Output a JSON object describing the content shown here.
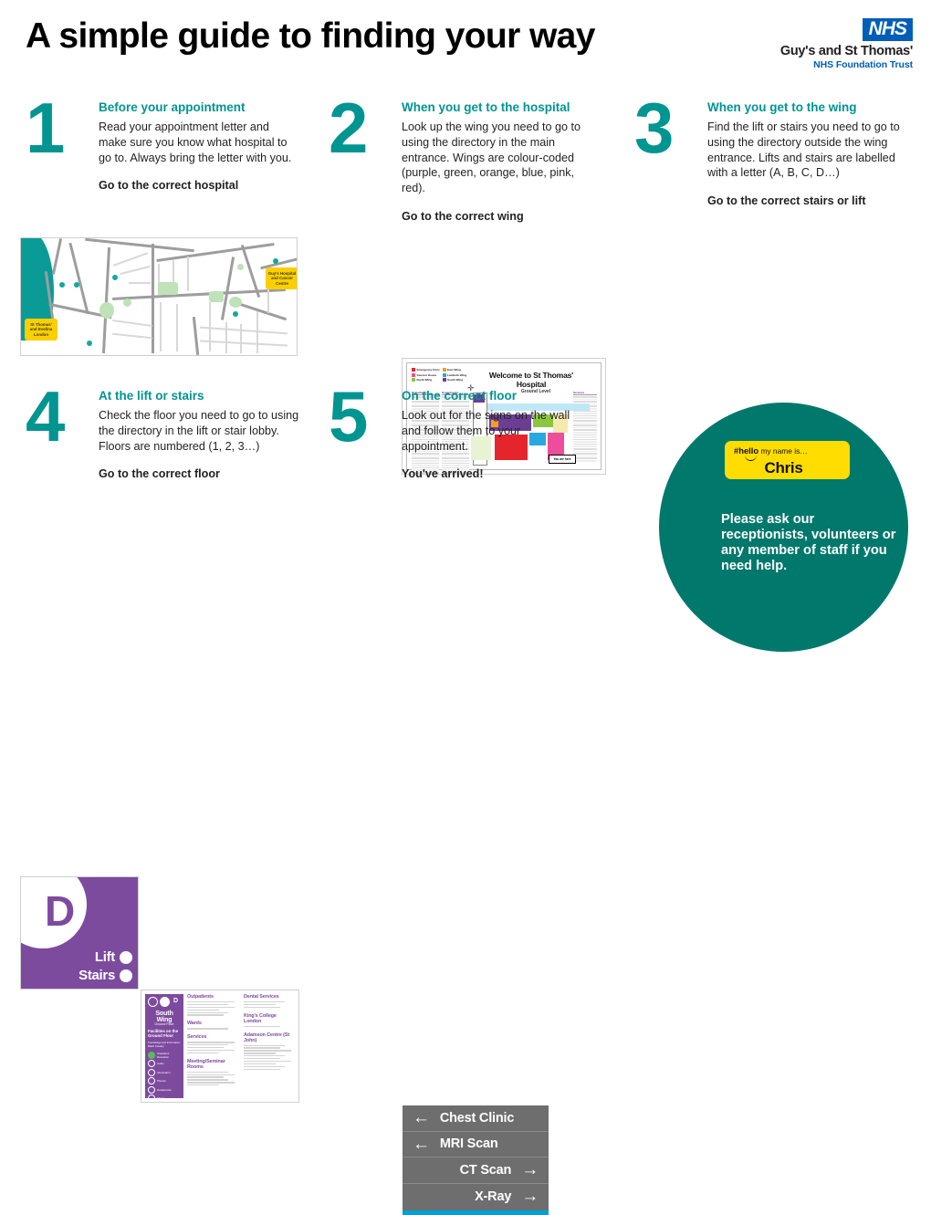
{
  "header": {
    "title": "A simple guide to finding your way",
    "logo": {
      "nhs": "NHS",
      "trust": "Guy's and St Thomas'",
      "trust_sub": "NHS Foundation Trust"
    }
  },
  "steps": [
    {
      "number": "1",
      "heading": "Before your appointment",
      "text": "Read your appointment letter and make sure you know what hospital to go to. Always bring the letter with you.",
      "action": "Go to the correct hospital"
    },
    {
      "number": "2",
      "heading": "When you get to the hospital",
      "text": "Look up the wing you need to go to using the directory in the main entrance. Wings are colour-coded (purple, green, orange, blue, pink, red).",
      "action": "Go to the correct wing"
    },
    {
      "number": "3",
      "heading": "When you get to the wing",
      "text": "Find the lift or stairs you need to go to using the directory outside the wing entrance. Lifts and stairs are labelled with a letter (A, B, C, D…)",
      "action": "Go to the correct stairs or lift"
    },
    {
      "number": "4",
      "heading": "At the lift or stairs",
      "text": "Check the floor you need to go to using the directory in the lift or stair lobby. Floors are numbered (1, 2, 3…)",
      "action": "Go to the correct floor"
    },
    {
      "number": "5",
      "heading": "On the correct floor",
      "text": "Look out for the signs on the wall and follow them to your appointment.",
      "action": "You've arrived!"
    }
  ],
  "map_image": {
    "pins": [
      {
        "label": "St Thomas' and Evelina London"
      },
      {
        "label": "Guy's Hospital and Cancer Centre"
      }
    ],
    "river_colour": "#0a9b96",
    "pin_colour": "#fccf00"
  },
  "hospital_poster": {
    "title": "Welcome to St Thomas' Hospital",
    "subtitle": "Ground Level",
    "you_are_here": "You are here",
    "legend": [
      {
        "label": "Emergency Floor",
        "colour": "#e4262c"
      },
      {
        "label": "East Wing",
        "colour": "#f6a01a"
      },
      {
        "label": "Gassiot House",
        "colour": "#ee4d9b"
      },
      {
        "label": "Lambeth Wing",
        "colour": "#29a8e0"
      },
      {
        "label": "North Wing",
        "colour": "#8cc63e"
      },
      {
        "label": "South Wing",
        "colour": "#6b3e94"
      }
    ],
    "index_columns": [
      "Outpatients",
      "Departments",
      "Services"
    ]
  },
  "wing_sign": {
    "title": "South Wing",
    "band_colour": "#6b3e94"
  },
  "lift_tile": {
    "letter": "D",
    "rows": [
      "Lift",
      "Stairs"
    ],
    "colour": "#7d4b9e"
  },
  "directory_board": {
    "wing": "South Wing",
    "floor": "Ground Floor",
    "facilities_heading": "Facilities on the Ground Floor",
    "facilities_sub": "Knowledge and Information\nBlack Cavalry",
    "facilities_list": [
      "Outpatient Reception",
      "Cafes",
      "Information",
      "Phones",
      "Restaurants",
      "Shops"
    ],
    "columns": [
      {
        "sections": [
          "Outpatients",
          "Wards",
          "Services",
          "Meeting/Seminar Rooms"
        ]
      },
      {
        "sections": [
          "Dental Services",
          "King's College London",
          "Adamson Centre (St John)"
        ]
      }
    ]
  },
  "corridor_sign": {
    "rows": [
      {
        "label": "Chest Clinic",
        "direction": "left",
        "arrow": "←"
      },
      {
        "label": "MRI Scan",
        "direction": "left",
        "arrow": "←"
      },
      {
        "label": "CT Scan",
        "direction": "right",
        "arrow": "→"
      },
      {
        "label": "X-Ray",
        "direction": "right",
        "arrow": "→"
      }
    ],
    "background": "#6e6e6e",
    "accent_bar": "#00a0d2"
  },
  "help_circle": {
    "badge_hash": "#",
    "badge_hello": "hello",
    "badge_rest": "my name is…",
    "badge_name": "Chris",
    "message": "Please ask our receptionists, volunteers or any member of staff if you need help.",
    "circle_colour": "#00786B",
    "badge_colour": "#FFDD00"
  },
  "theme": {
    "teal": "#009591",
    "nhs_blue": "#005EB8",
    "purple": "#7d4b9e"
  }
}
